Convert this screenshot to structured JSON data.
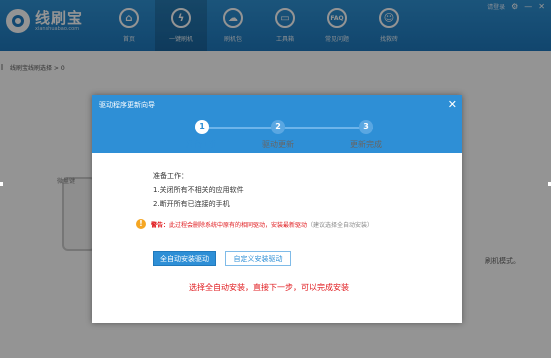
{
  "app": {
    "logo_title": "线刷宝",
    "logo_sub": "xianshuabao.com"
  },
  "nav": [
    {
      "label": "首页",
      "icon": "home-icon",
      "glyph": "⌂"
    },
    {
      "label": "一键刷机",
      "icon": "flash-icon",
      "glyph": "ϟ"
    },
    {
      "label": "刷机包",
      "icon": "cloud-download-icon",
      "glyph": "☁"
    },
    {
      "label": "工具箱",
      "icon": "toolbox-icon",
      "glyph": "▭"
    },
    {
      "label": "常见问题",
      "icon": "faq-icon",
      "glyph": "FAQ"
    },
    {
      "label": "找救砖",
      "icon": "rescue-icon",
      "glyph": "☺"
    }
  ],
  "window": {
    "login": "请登录",
    "controls": [
      "⚙",
      "—",
      "✕"
    ]
  },
  "background": {
    "path_text": "线刷宝线刷选择 > 0",
    "device_label": "微量键",
    "right_label": "刷机模式。"
  },
  "dialog": {
    "title": "驱动程序更新向导",
    "steps": [
      {
        "number": "1",
        "label": "准备工作"
      },
      {
        "number": "2",
        "label": "驱动更新"
      },
      {
        "number": "3",
        "label": "更新完成"
      }
    ],
    "prepare_title": "准备工作：",
    "prepare_items": [
      "1.关闭所有不相关的应用软件",
      "2.断开所有已连接的手机"
    ],
    "warning_label": "警告：",
    "warning_text": "此过程会删除系统中原有的相同驱动，安装最新驱动",
    "warning_hint": "（建议选择全自动安装）",
    "btn_auto": "全自动安装驱动",
    "btn_custom": "自定义安装驱动",
    "bottom_hint": "选择全自动安装，直接下一步，可以完成安装"
  },
  "colors": {
    "accent": "#2e8fd6",
    "warning": "#e0191d",
    "warning_icon": "#f5a623"
  }
}
